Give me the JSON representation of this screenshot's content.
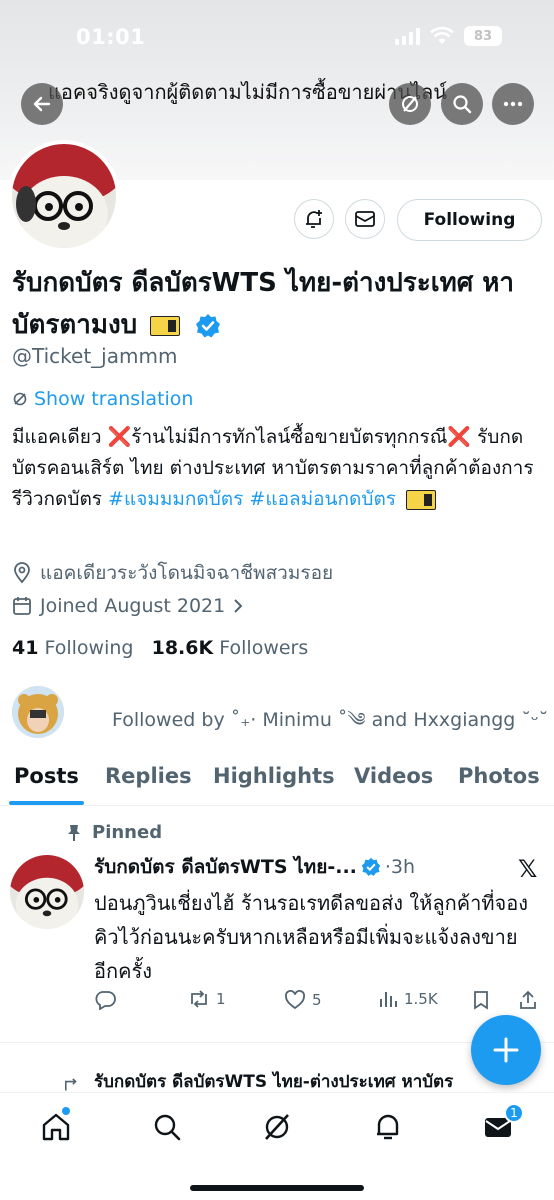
{
  "status_bar": {
    "time": "01:01",
    "battery": "83"
  },
  "header": {
    "title": "แอคจริงดูจากผู้ติดตามไม่มีการซื้อขายผ่านไลน์"
  },
  "profile": {
    "display_name": "รับกดบัตร ดีลบัตรWTS ไทย-ต่างประเทศ หาบัตรตามงบ",
    "handle": "@Ticket_jammm",
    "follow_label": "Following",
    "show_translation": "Show translation",
    "bio_parts": {
      "p1": "มีแอคเดียว ",
      "x1": "❌",
      "p2": "ร้านไม่มีการทักไลน์ซื้อขายบัตรทุกกรณี",
      "x2": "❌",
      "p3": " รับกดบัตรคอนเสิร์ต ไทย ต่างประเทศ หาบัตรตามราคาที่ลูกค้าต้องการ รีวิวกดบัตร ",
      "tag1": "#แจมมมกดบัตร",
      "tag2": "#แอลม่อนกดบัตร"
    },
    "location": "แอคเดียวระวังโดนมิจฉาชีพสวมรอย",
    "joined": "Joined August 2021",
    "following_count": "41",
    "following_label": "Following",
    "followers_count": "18.6K",
    "followers_label": "Followers",
    "followed_by": "Followed by ˚₊‧ Minimu ˚༄ and Hxxgiangg ˘ᵕ˘"
  },
  "tabs": [
    "Posts",
    "Replies",
    "Highlights",
    "Videos",
    "Photos"
  ],
  "pinned_post": {
    "pinned_label": "Pinned",
    "author": "รับกดบัตร ดีลบัตรWTS ไทย-...",
    "time": "·3h",
    "text": "ปอนภูวินเชี่ยงไฮ้ ร้านรอเรทดีลขอส่ง ให้ลูกค้าที่จองคิวไว้ก่อนนะครับหากเหลือหรือมีเพิ่มจะแจ้งลงขายอีกครั้ง",
    "reposts": "1",
    "likes": "5",
    "views": "1.5K"
  },
  "next_post": {
    "author": "รับกดบัตร ดีลบัตรWTS ไทย-ต่างประเทศ หาบัตร"
  },
  "bottom_nav": {
    "messages_badge": "1"
  },
  "colors": {
    "accent": "#1d9bf0",
    "text": "#0f1419",
    "muted": "#536471",
    "x_mark": "#e0202a"
  }
}
